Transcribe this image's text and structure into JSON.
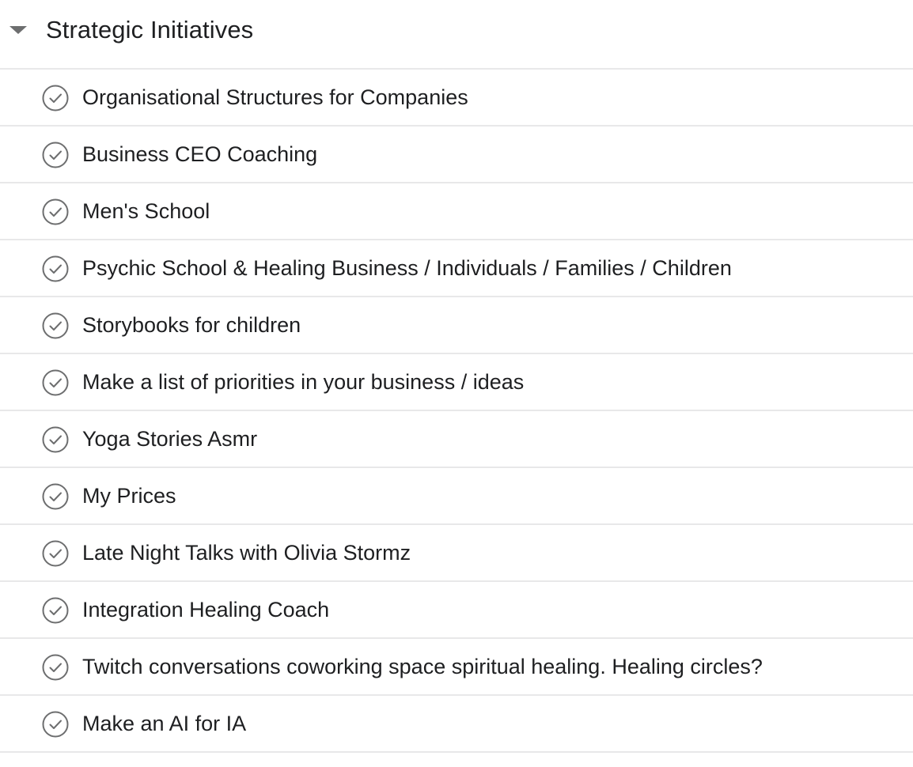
{
  "section": {
    "title": "Strategic Initiatives",
    "collapse_icon": "caret-down-icon"
  },
  "colors": {
    "text": "#1e1f21",
    "divider": "#e8e8e9",
    "check_icon": "#6d6e6f"
  },
  "tasks": [
    {
      "name": "Organisational Structures for Companies",
      "icon": "check-circle-icon",
      "completed": false
    },
    {
      "name": "Business CEO Coaching",
      "icon": "check-circle-icon",
      "completed": false
    },
    {
      "name": "Men's School",
      "icon": "check-circle-icon",
      "completed": false
    },
    {
      "name": "Psychic School & Healing Business / Individuals / Families / Children",
      "icon": "check-circle-icon",
      "completed": false
    },
    {
      "name": "Storybooks for children",
      "icon": "check-circle-icon",
      "completed": false
    },
    {
      "name": "Make a list of priorities in your business / ideas",
      "icon": "check-circle-icon",
      "completed": false
    },
    {
      "name": "Yoga Stories Asmr",
      "icon": "check-circle-icon",
      "completed": false
    },
    {
      "name": "My Prices",
      "icon": "check-circle-icon",
      "completed": false
    },
    {
      "name": "Late Night Talks with Olivia Stormz",
      "icon": "check-circle-icon",
      "completed": false
    },
    {
      "name": "Integration Healing Coach",
      "icon": "check-circle-icon",
      "completed": false
    },
    {
      "name": "Twitch conversations coworking space spiritual healing. Healing circles?",
      "icon": "check-circle-icon",
      "completed": false
    },
    {
      "name": "Make an AI for IA",
      "icon": "check-circle-icon",
      "completed": false
    }
  ]
}
